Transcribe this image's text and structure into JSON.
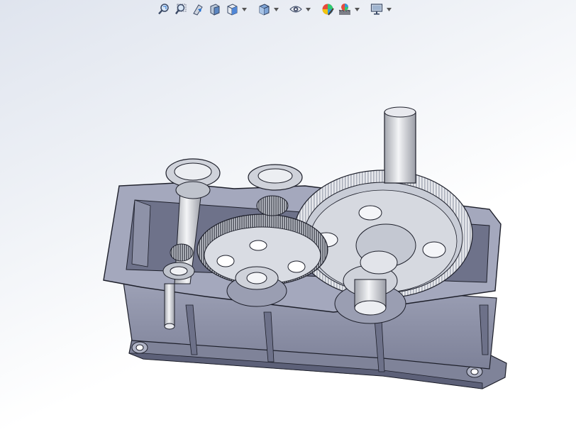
{
  "app": {
    "window_title": ""
  },
  "toolbar": {
    "items": [
      {
        "icon": "zoom-to-fit-icon",
        "has_dropdown": false
      },
      {
        "icon": "zoom-to-area-icon",
        "has_dropdown": false
      },
      {
        "icon": "previous-view-icon",
        "has_dropdown": false
      },
      {
        "icon": "section-view-icon",
        "has_dropdown": false
      },
      {
        "icon": "view-orientation-icon",
        "has_dropdown": true
      },
      {
        "icon": "display-style-icon",
        "has_dropdown": true
      },
      {
        "icon": "hide-show-items-icon",
        "has_dropdown": true
      },
      {
        "icon": "edit-appearance-icon",
        "has_dropdown": false
      },
      {
        "icon": "apply-scene-icon",
        "has_dropdown": true
      },
      {
        "icon": "view-settings-icon",
        "has_dropdown": true
      }
    ]
  },
  "graphics_area": {
    "model": "gearbox-assembly",
    "background_gradient": [
      "#dfe4ee",
      "#ffffff"
    ]
  },
  "colors": {
    "housing": "#8b8fa6",
    "housing_dark": "#5c6078",
    "housing_light": "#a9adc2",
    "gear_steel": "#c9ccd4",
    "gear_light": "#eceef2",
    "shaft": "#dcdde2",
    "edge": "#1d1f2a"
  }
}
